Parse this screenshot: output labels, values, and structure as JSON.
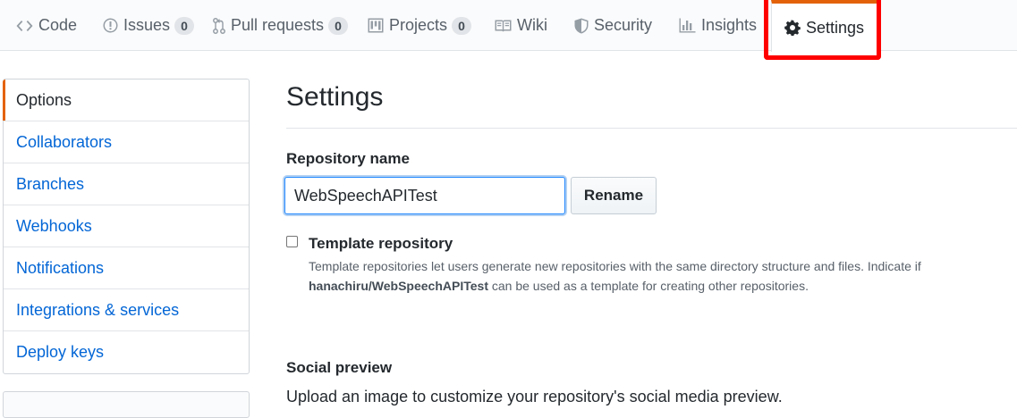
{
  "tabs": [
    {
      "label": "Code",
      "icon": "code-icon"
    },
    {
      "label": "Issues",
      "icon": "issue-opened-icon",
      "count": "0"
    },
    {
      "label": "Pull requests",
      "icon": "git-pull-request-icon",
      "count": "0"
    },
    {
      "label": "Projects",
      "icon": "project-icon",
      "count": "0"
    },
    {
      "label": "Wiki",
      "icon": "book-icon"
    },
    {
      "label": "Security",
      "icon": "shield-icon"
    },
    {
      "label": "Insights",
      "icon": "graph-icon"
    },
    {
      "label": "Settings",
      "icon": "gear-icon",
      "selected": true
    }
  ],
  "sidebar": {
    "items": [
      {
        "label": "Options",
        "selected": true
      },
      {
        "label": "Collaborators"
      },
      {
        "label": "Branches"
      },
      {
        "label": "Webhooks"
      },
      {
        "label": "Notifications"
      },
      {
        "label": "Integrations & services"
      },
      {
        "label": "Deploy keys"
      }
    ]
  },
  "main": {
    "title": "Settings",
    "repo_name_label": "Repository name",
    "repo_name_value": "WebSpeechAPITest",
    "rename_label": "Rename",
    "template": {
      "label": "Template repository",
      "checked": false,
      "note_before": "Template repositories let users generate new repositories with the same directory structure and files. Indicate if ",
      "note_repo": "hanachiru/WebSpeechAPITest",
      "note_after": " can be used as a template for creating other repositories."
    },
    "social_preview": {
      "title": "Social preview",
      "description": "Upload an image to customize your repository's social media preview."
    }
  },
  "colors": {
    "accent": "#e36209",
    "link": "#0366d6",
    "highlight": "#ff0000"
  }
}
